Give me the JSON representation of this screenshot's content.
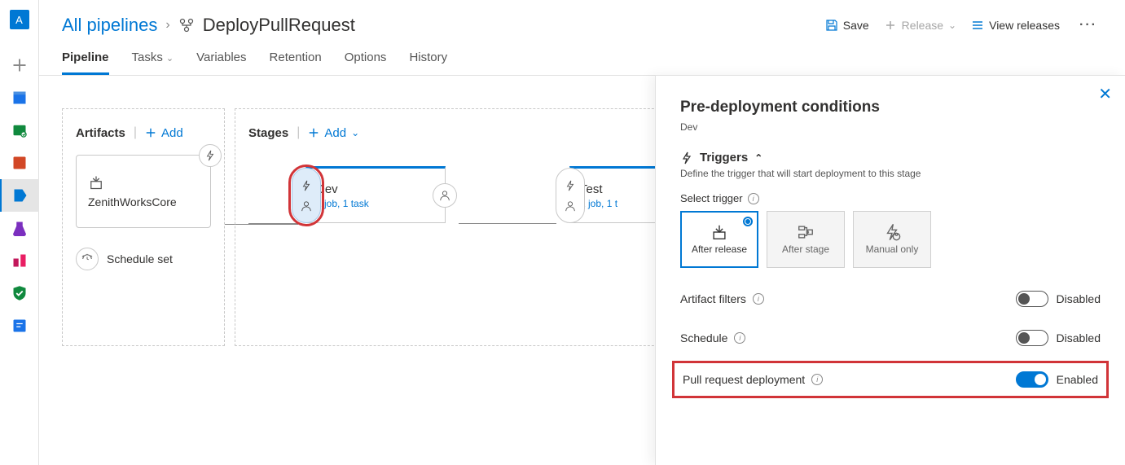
{
  "avatar_initial": "A",
  "breadcrumb": {
    "root": "All pipelines",
    "sep": "›",
    "name": "DeployPullRequest"
  },
  "toolbar": {
    "save": "Save",
    "release": "Release",
    "view_releases": "View releases"
  },
  "tabs": {
    "pipeline": "Pipeline",
    "tasks": "Tasks",
    "variables": "Variables",
    "retention": "Retention",
    "options": "Options",
    "history": "History"
  },
  "artifacts": {
    "title": "Artifacts",
    "add": "Add",
    "artifact_name": "ZenithWorksCore",
    "schedule": "Schedule set"
  },
  "stages": {
    "title": "Stages",
    "add": "Add",
    "dev": {
      "name": "Dev",
      "sub": "1 job, 1 task"
    },
    "test": {
      "name": "Test",
      "sub": "1 job, 1 t"
    }
  },
  "panel": {
    "title": "Pre-deployment conditions",
    "stage": "Dev",
    "triggers_head": "Triggers",
    "triggers_desc": "Define the trigger that will start deployment to this stage",
    "select_trigger": "Select trigger",
    "options": {
      "after_release": "After release",
      "after_stage": "After stage",
      "manual_only": "Manual only"
    },
    "artifact_filters": "Artifact filters",
    "schedule": "Schedule",
    "pr_deployment": "Pull request deployment",
    "disabled": "Disabled",
    "enabled": "Enabled"
  }
}
